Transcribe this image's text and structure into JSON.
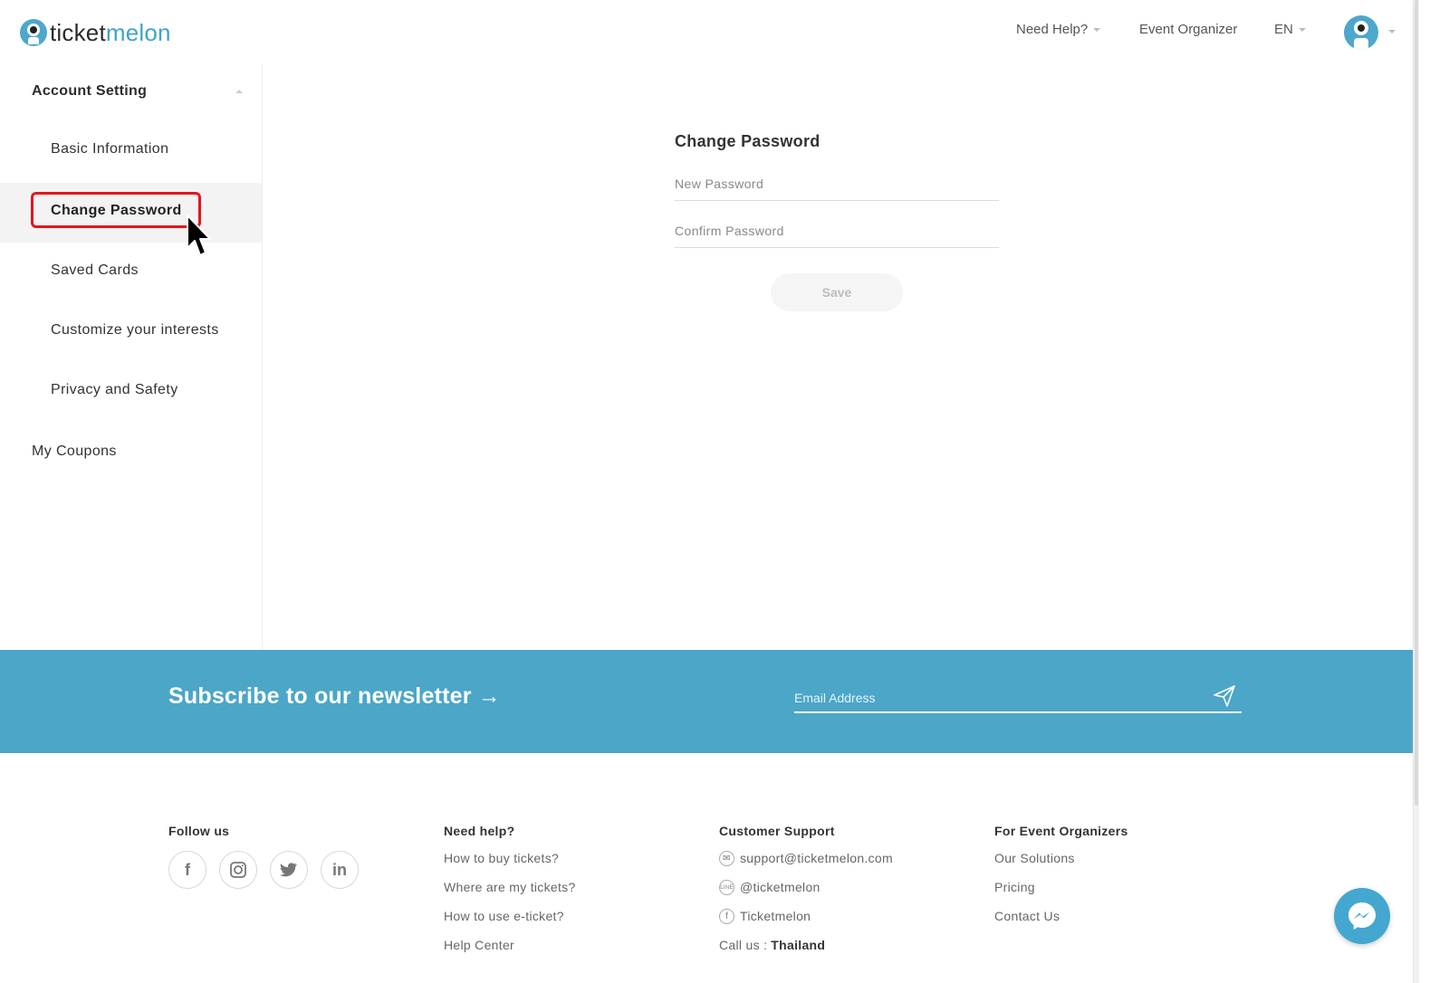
{
  "header": {
    "logo_text_a": "ticket",
    "logo_text_b": "melon",
    "nav": {
      "need_help": "Need Help?",
      "event_organizer": "Event Organizer",
      "language": "EN"
    }
  },
  "sidebar": {
    "heading": "Account Setting",
    "items": [
      {
        "label": "Basic Information",
        "active": false
      },
      {
        "label": "Change Password",
        "active": true
      },
      {
        "label": "Saved Cards",
        "active": false
      },
      {
        "label": "Customize your interests",
        "active": false
      },
      {
        "label": "Privacy and Safety",
        "active": false
      }
    ],
    "coupons": "My Coupons"
  },
  "form": {
    "title": "Change Password",
    "new_password_placeholder": "New Password",
    "confirm_password_placeholder": "Confirm Password",
    "save_label": "Save"
  },
  "newsletter": {
    "title": "Subscribe to our newsletter →",
    "email_placeholder": "Email Address"
  },
  "footer": {
    "follow_us": "Follow us",
    "social": [
      "f",
      "instagram",
      "twitter",
      "in"
    ],
    "need_help": {
      "heading": "Need help?",
      "links": [
        "How to buy tickets?",
        "Where are my tickets?",
        "How to use e-ticket?",
        "Help Center"
      ]
    },
    "customer_support": {
      "heading": "Customer Support",
      "email": "support@ticketmelon.com",
      "line": "@ticketmelon",
      "facebook": "Ticketmelon",
      "call_prefix": "Call us :",
      "call_country": "Thailand"
    },
    "organizers": {
      "heading": "For Event Organizers",
      "links": [
        "Our Solutions",
        "Pricing",
        "Contact Us"
      ]
    }
  },
  "colors": {
    "brand": "#4ba6c8",
    "highlight": "#e8141c"
  }
}
